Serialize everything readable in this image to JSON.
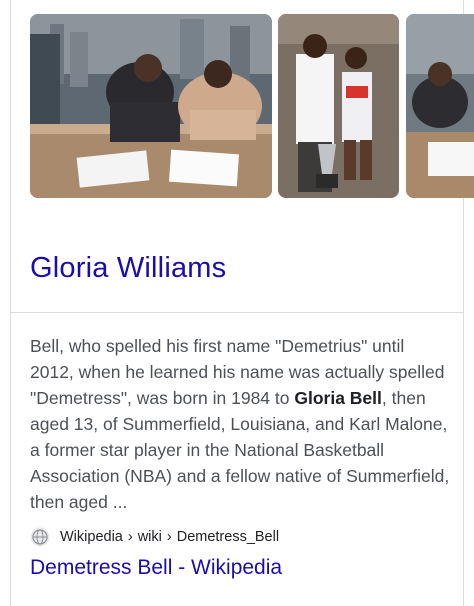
{
  "images": [
    {
      "alt": "Two people signing documents at a table"
    },
    {
      "alt": "Man and woman posing with a trophy"
    },
    {
      "alt": "Man signing documents"
    }
  ],
  "entity": {
    "title": "Gloria Williams"
  },
  "snippet": {
    "t1": "Bell, who spelled his first name \"Demetrius\" until 2012, when he learned his name was actually spelled \"Demetress\", was born in 1984 to ",
    "bold": "Gloria Bell",
    "t2": ", then aged 13, of Summerfield, Louisiana, and Karl Malone, a former star player in the National Basketball Association (NBA) and a fellow native of Summerfield, then aged ..."
  },
  "source": {
    "icon": "globe-icon",
    "site": "Wikipedia",
    "separator1": "›",
    "path1": "wiki",
    "separator2": "›",
    "path2": "Demetress_Bell"
  },
  "result": {
    "title": "Demetress Bell - Wikipedia"
  },
  "colors": {
    "link": "#1a0dab",
    "text": "#4d5156",
    "border": "#dadce0"
  }
}
